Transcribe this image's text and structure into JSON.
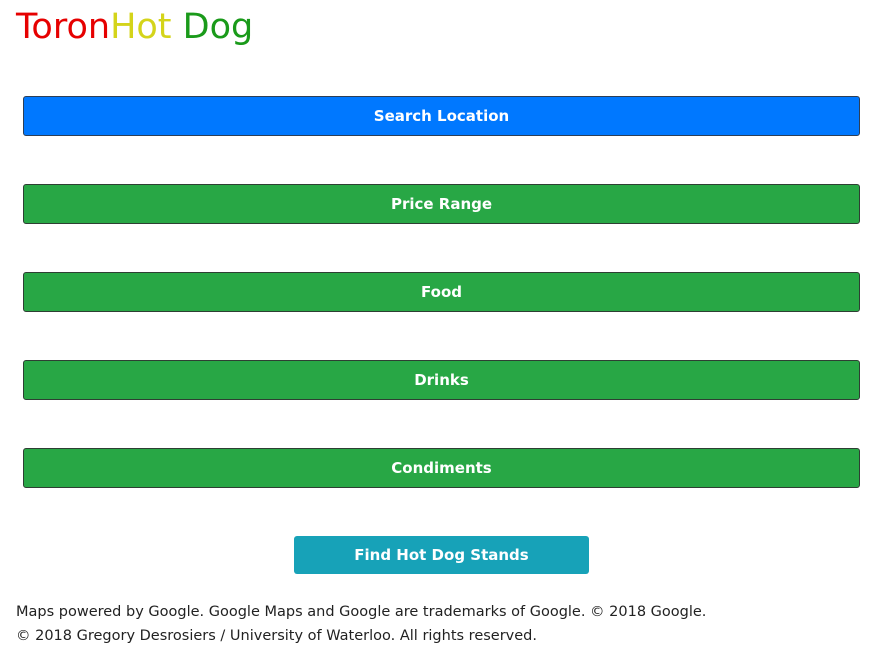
{
  "header": {
    "title_part1": "Toron",
    "title_part2": "Hot",
    "title_part3": " Dog",
    "colors": {
      "part1": "#e60000",
      "part2": "#d4d41a",
      "part3": "#1a9a1a"
    }
  },
  "filters": [
    {
      "label": "Search Location",
      "color": "#0078ff"
    },
    {
      "label": "Price Range",
      "color": "#28a745"
    },
    {
      "label": "Food",
      "color": "#28a745"
    },
    {
      "label": "Drinks",
      "color": "#28a745"
    },
    {
      "label": "Condiments",
      "color": "#28a745"
    }
  ],
  "action": {
    "find_label": "Find Hot Dog Stands",
    "color": "#17a2b8"
  },
  "footer": {
    "line1": "Maps powered by Google. Google Maps and Google are trademarks of Google. © 2018 Google.",
    "line2": "© 2018 Gregory Desrosiers / University of Waterloo. All rights reserved."
  }
}
